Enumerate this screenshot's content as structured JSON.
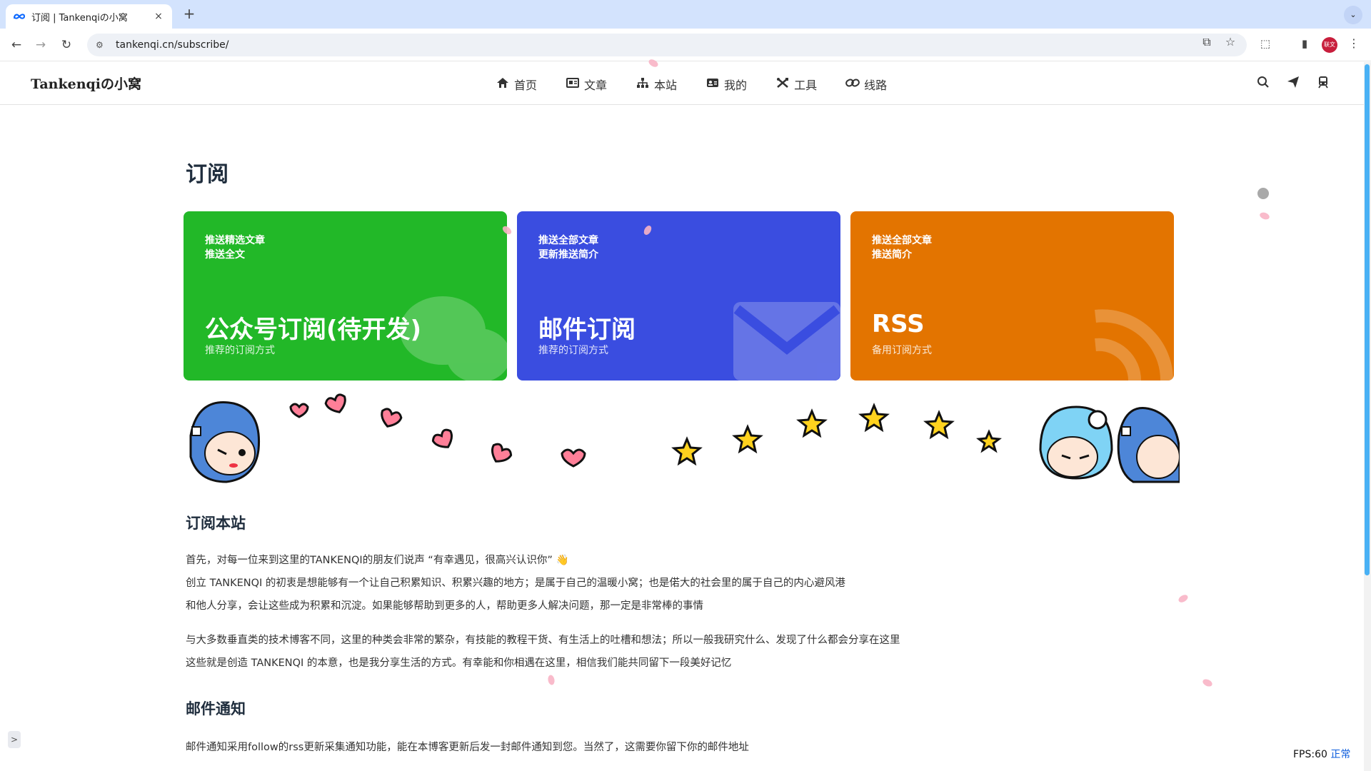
{
  "browser": {
    "tab_title": "订阅 | Tankenqiの小窝",
    "tab_close": "×",
    "new_tab": "+",
    "tab_menu": "⌄",
    "url": "tankenqi.cn/subscribe/",
    "back": "←",
    "forward": "→",
    "reload": "↻",
    "site_info": "⚙",
    "cast_icon": "⧉",
    "bookmark_icon": "☆",
    "extensions_icon": "⬚",
    "sidepanel_icon": "▮",
    "profile_label": "联文",
    "menu_icon": "⋮"
  },
  "site": {
    "brand": "Tankenqiの小窝",
    "menu": [
      {
        "icon": "⌂",
        "label": "首页"
      },
      {
        "icon": "▤",
        "label": "文章"
      },
      {
        "icon": "⚲",
        "label": "本站"
      },
      {
        "icon": "▣",
        "label": "我的"
      },
      {
        "icon": "✕",
        "label": "工具"
      },
      {
        "icon": "∞",
        "label": "线路"
      }
    ],
    "search_icon": "⚲",
    "send_icon": "➤",
    "train_icon": "▣"
  },
  "page": {
    "title": "订阅",
    "cards": [
      {
        "tag1": "推送精选文章",
        "tag2": "推送全文",
        "title": "公众号订阅(待开发)",
        "sub": "推荐的订阅方式",
        "color": "#22b828"
      },
      {
        "tag1": "推送全部文章",
        "tag2": "更新推送简介",
        "title": "邮件订阅",
        "sub": "推荐的订阅方式",
        "color": "#3a4de0"
      },
      {
        "tag1": "推送全部文章",
        "tag2": "推送简介",
        "title": "RSS",
        "sub": "备用订阅方式",
        "color": "#e37400"
      }
    ],
    "section1_title": "订阅本站",
    "p1_line1": "首先，对每一位来到这里的TANKENQI的朋友们说声 “有幸遇见，很高兴认识你” 👋",
    "p1_line2": "创立 TANKENQI 的初衷是想能够有一个让自己积累知识、积累兴趣的地方；是属于自己的温暖小窝；也是偌大的社会里的属于自己的内心避风港",
    "p1_line3": "和他人分享，会让这些成为积累和沉淀。如果能够帮助到更多的人，帮助更多人解决问题，那一定是非常棒的事情",
    "p2_line1": "与大多数垂直类的技术博客不同，这里的种类会非常的繁杂，有技能的教程干货、有生活上的吐槽和想法；所以一般我研究什么、发现了什么都会分享在这里",
    "p2_line2": "这些就是创造 TANKENQI 的本意，也是我分享生活的方式。有幸能和你相遇在这里，相信我们能共同留下一段美好记忆",
    "section2_title": "邮件通知",
    "p3_line1": "邮件通知采用follow的rss更新采集通知功能，能在本博客更新后发一封邮件通知到您。当然了，这需要你留下你的邮件地址"
  },
  "overlay": {
    "side_toggle": ">",
    "fps_label": "FPS:60",
    "fps_status": "正常"
  }
}
